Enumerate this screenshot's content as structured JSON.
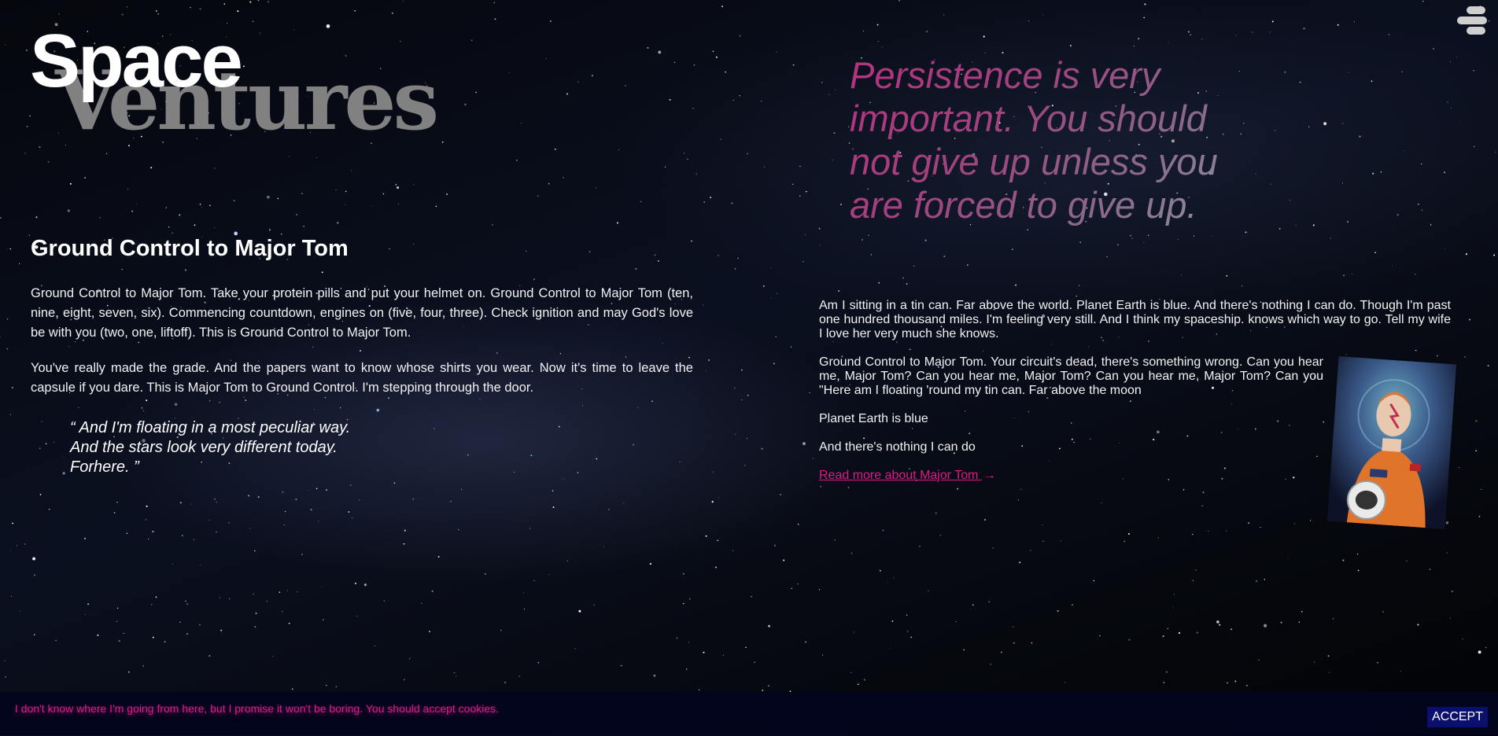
{
  "logo": {
    "line1": "Space",
    "line2": "Ventures"
  },
  "menu": {
    "icon": "hamburger-menu-icon"
  },
  "left": {
    "heading": "Ground Control to Major Tom",
    "paragraphs": [
      "Ground Control to Major Tom. Take your protein pills and put your helmet on. Ground Control to Major Tom (ten, nine, eight, seven, six). Commencing countdown, engines on (five, four, three). Check ignition and may God's love be with you (two, one, liftoff). This is Ground Control to Major Tom.",
      "You've really made the grade. And the papers want to know whose shirts you wear. Now it's time to leave the capsule if you dare. This is Major Tom to Ground Control. I'm stepping through the door."
    ],
    "quote_lines": [
      "“ And I'm floating in a most peculiar way.",
      "And the stars look very different today.",
      "Forhere. ”"
    ]
  },
  "right": {
    "big_quote": "Persistence is very important. You should not give up unless you are forced to give up.",
    "paragraphs": [
      "Am I sitting in a tin can. Far above the world. Planet Earth is blue. And there's nothing I can do. Though I'm past one hundred thousand miles. I'm feeling very still. And I think my spaceship. knows which way to go. Tell my wife I love her very much she knows.",
      "Ground Control to Major Tom. Your circuit's dead, there's something wrong. Can you hear me, Major Tom? Can you hear me, Major Tom? Can you hear me, Major Tom? Can you \"Here am I floating 'round my tin can. Far above the moon",
      "Planet Earth is blue",
      "And there's nothing I can do"
    ],
    "read_more": "Read more about Major Tom",
    "arrow_icon": "arrow-right-icon"
  },
  "cookie": {
    "text": "I don't know where I'm going from here, but I promise it won't be boring. You should accept cookies.",
    "accept": "ACCEPT"
  },
  "colors": {
    "accent": "#e0188a",
    "cookie_bg": "#03051c",
    "accept_bg": "#0b0f6e"
  }
}
